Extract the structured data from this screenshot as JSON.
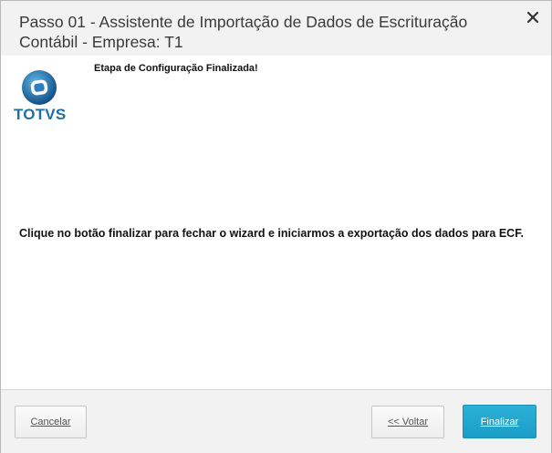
{
  "dialog": {
    "title": "Passo 01 - Assistente de Importação de Dados de Escrituração Contábil - Empresa: T1",
    "close_icon": "close-icon"
  },
  "logo": {
    "text": "TOTVS",
    "brand_color": "#1f6fa3"
  },
  "content": {
    "step_heading": "Etapa de Configuração Finalizada!",
    "message": "Clique no botão finalizar para fechar o wizard e iniciarmos a exportação dos dados para ECF."
  },
  "footer": {
    "cancel_label": "Cancelar",
    "back_label": "<< Voltar",
    "finish_label": "Finalizar",
    "finish_color": "#1fa6d0"
  }
}
